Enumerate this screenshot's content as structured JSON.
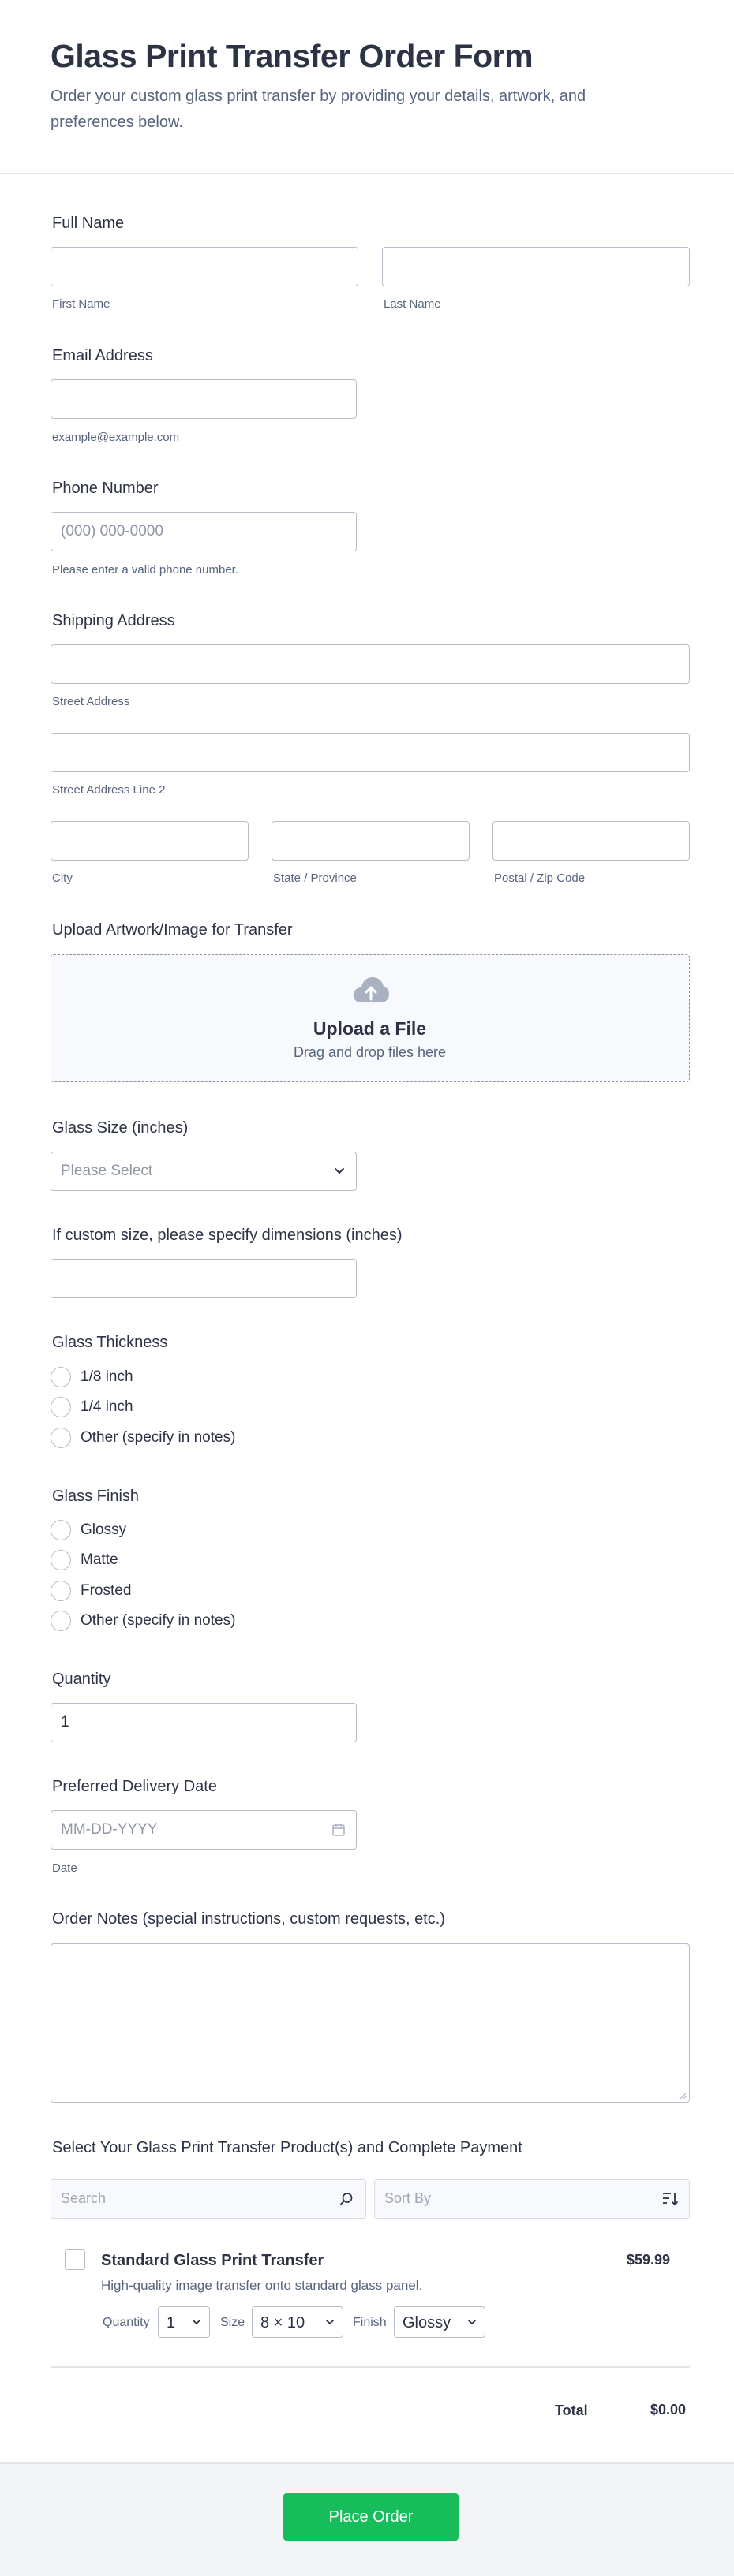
{
  "header": {
    "title": "Glass Print Transfer Order Form",
    "subtitle": "Order your custom glass print transfer by providing your details, artwork, and preferences below."
  },
  "full_name": {
    "label": "Full Name",
    "first_sub": "First Name",
    "last_sub": "Last Name"
  },
  "email": {
    "label": "Email Address",
    "sub": "example@example.com"
  },
  "phone": {
    "label": "Phone Number",
    "placeholder": "(000) 000-0000",
    "sub": "Please enter a valid phone number."
  },
  "address": {
    "label": "Shipping Address",
    "street_sub": "Street Address",
    "street2_sub": "Street Address Line 2",
    "city_sub": "City",
    "state_sub": "State / Province",
    "zip_sub": "Postal / Zip Code"
  },
  "upload": {
    "label": "Upload Artwork/Image for Transfer",
    "title": "Upload a File",
    "sub": "Drag and drop files here"
  },
  "glass_size": {
    "label": "Glass Size (inches)",
    "placeholder": "Please Select"
  },
  "custom_size": {
    "label": "If custom size, please specify dimensions (inches)"
  },
  "thickness": {
    "label": "Glass Thickness",
    "options": [
      "1/8 inch",
      "1/4 inch",
      "Other (specify in notes)"
    ]
  },
  "finish": {
    "label": "Glass Finish",
    "options": [
      "Glossy",
      "Matte",
      "Frosted",
      "Other (specify in notes)"
    ]
  },
  "quantity": {
    "label": "Quantity",
    "value": "1"
  },
  "delivery": {
    "label": "Preferred Delivery Date",
    "placeholder": "MM-DD-YYYY",
    "sub": "Date"
  },
  "notes": {
    "label": "Order Notes (special instructions, custom requests, etc.)"
  },
  "products": {
    "label": "Select Your Glass Print Transfer Product(s) and Complete Payment",
    "search_placeholder": "Search",
    "sort_placeholder": "Sort By",
    "item": {
      "name": "Standard Glass Print Transfer",
      "price": "$59.99",
      "description": "High-quality image transfer onto standard glass panel.",
      "quantity_label": "Quantity",
      "quantity_value": "1",
      "size_label": "Size",
      "size_value": "8 × 10",
      "finish_label": "Finish",
      "finish_value": "Glossy"
    },
    "total_label": "Total",
    "total_value": "$0.00"
  },
  "submit": {
    "label": "Place Order"
  },
  "colors": {
    "accent": "#18bd5b",
    "text": "#2c3345",
    "muted": "#57647e",
    "border": "#b8bdc9"
  }
}
